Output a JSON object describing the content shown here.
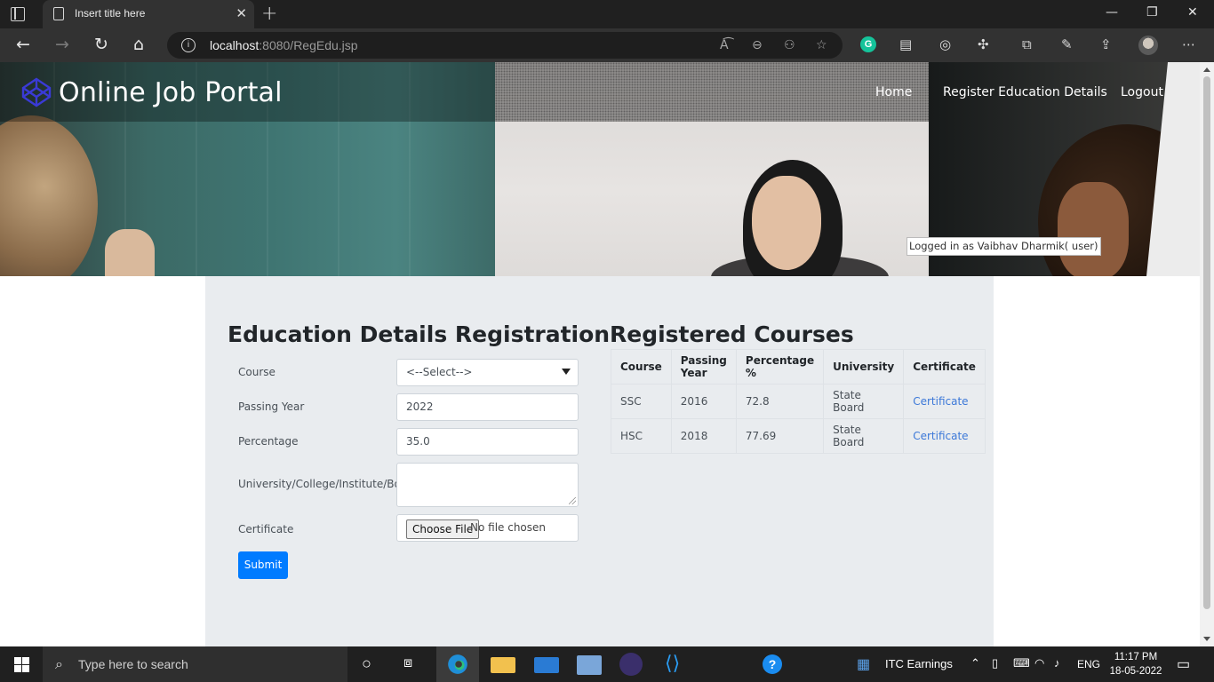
{
  "browser": {
    "tab_title": "Insert title here",
    "url_host": "localhost",
    "url_rest": ":8080/RegEdu.jsp"
  },
  "site": {
    "brand": "Online Job Portal",
    "nav": [
      {
        "label": "Home"
      },
      {
        "label": "Register Education Details"
      },
      {
        "label": "Logout"
      }
    ],
    "logged_in": "Logged in as Vaibhav Dharmik( user)"
  },
  "form": {
    "title": "Education Details Registration",
    "course_label": "Course",
    "course_selected": "<--Select-->",
    "year_label": "Passing Year",
    "year_placeholder": "2022",
    "percentage_label": "Percentage",
    "percentage_placeholder": "35.0",
    "university_label": "University/College/Institute/Board",
    "certificate_label": "Certificate",
    "file_button": "Choose File",
    "file_status": "No file chosen",
    "submit_label": "Submit"
  },
  "courses": {
    "title": "Registered Courses",
    "headers": [
      "Course",
      "Passing Year",
      "Percentage %",
      "University",
      "Certificate"
    ],
    "rows": [
      {
        "course": "SSC",
        "year": "2016",
        "percentage": "72.8",
        "university": "State Board",
        "certificate": "Certificate"
      },
      {
        "course": "HSC",
        "year": "2018",
        "percentage": "77.69",
        "university": "State Board",
        "certificate": "Certificate"
      }
    ]
  },
  "taskbar": {
    "search_placeholder": "Type here to search",
    "stock_text": "ITC  Earnings",
    "language": "ENG",
    "time": "11:17 PM",
    "date": "18-05-2022"
  },
  "colors": {
    "primary_button": "#007bff",
    "panel": "#e9ecef",
    "link": "#3c78d8"
  }
}
